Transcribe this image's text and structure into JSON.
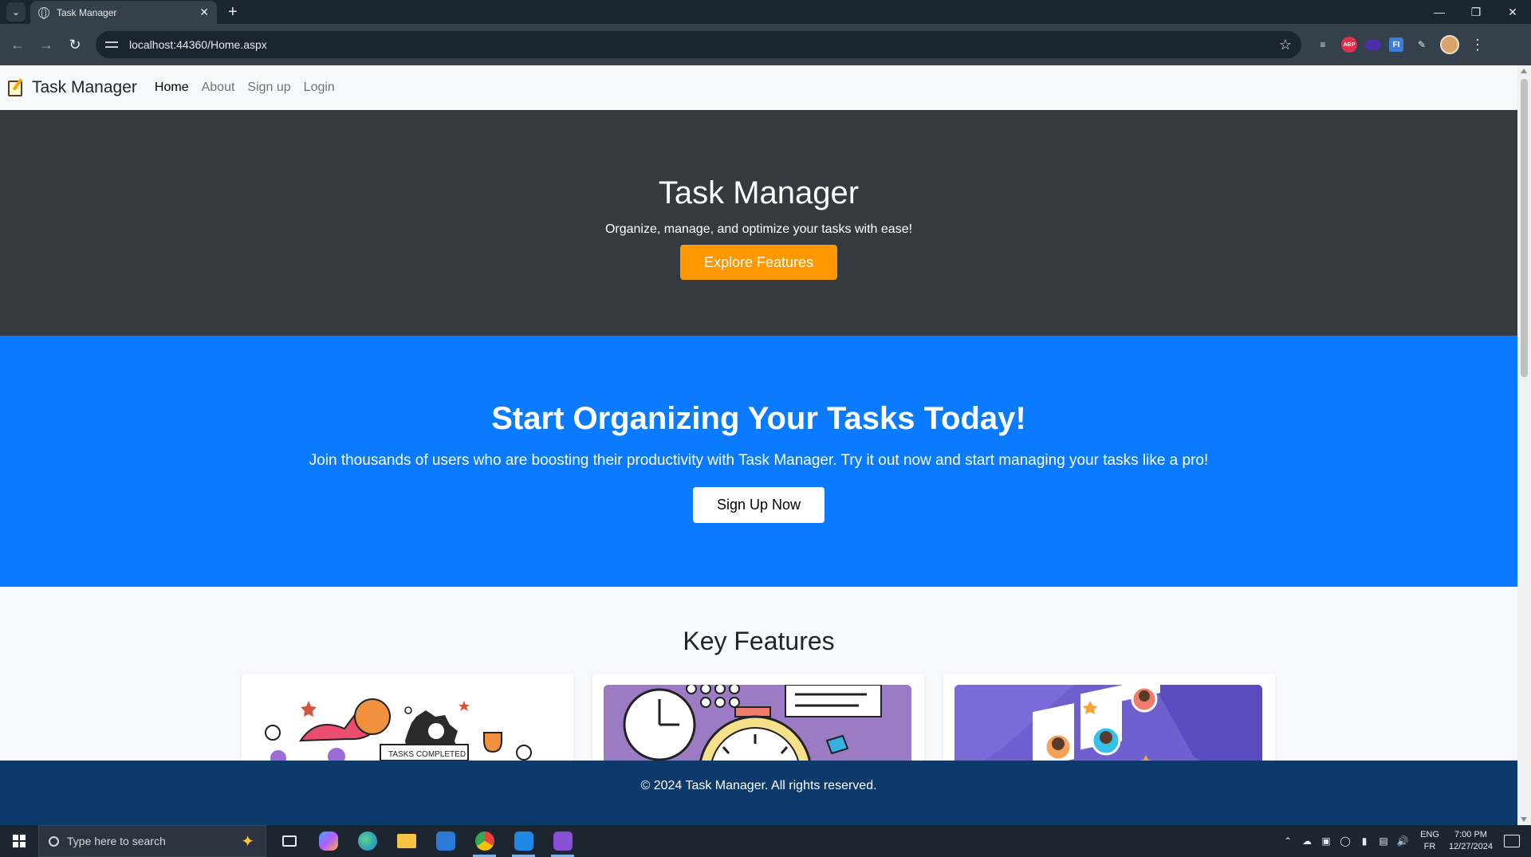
{
  "browser": {
    "tab_title": "Task Manager",
    "url": "localhost:44360/Home.aspx",
    "new_tab_label": "+",
    "extensions": [
      "translate-icon",
      "adblock-plus-icon",
      "ocean-extension-icon",
      "fi-extension-icon",
      "puzzle-icon",
      "profile-avatar",
      "kebab-menu-icon"
    ],
    "abp_label": "ABP",
    "fi_label": "FI"
  },
  "navbar": {
    "brand": "Task Manager",
    "links": [
      "Home",
      "About",
      "Sign up",
      "Login"
    ]
  },
  "hero": {
    "title": "Task Manager",
    "subtitle": "Organize, manage, and optimize your tasks with ease!",
    "button": "Explore Features"
  },
  "cta": {
    "title": "Start Organizing Your Tasks Today!",
    "text": "Join thousands of users who are boosting their productivity with Task Manager. Try it out now and start managing your tasks like a pro!",
    "button": "Sign Up Now"
  },
  "features": {
    "title": "Key Features",
    "card1_caption": "TASKS COMPLETED"
  },
  "footer": {
    "text": "© 2024 Task Manager. All rights reserved."
  },
  "taskbar": {
    "search_placeholder": "Type here to search",
    "lang_top": "ENG",
    "lang_bottom": "FR",
    "time": "7:00 PM",
    "date": "12/27/2024"
  },
  "colors": {
    "hero_bg": "#343a40",
    "cta_bg": "#0a7bfe",
    "explore_button": "#fd9802",
    "footer_bg": "#0e3a6b"
  }
}
